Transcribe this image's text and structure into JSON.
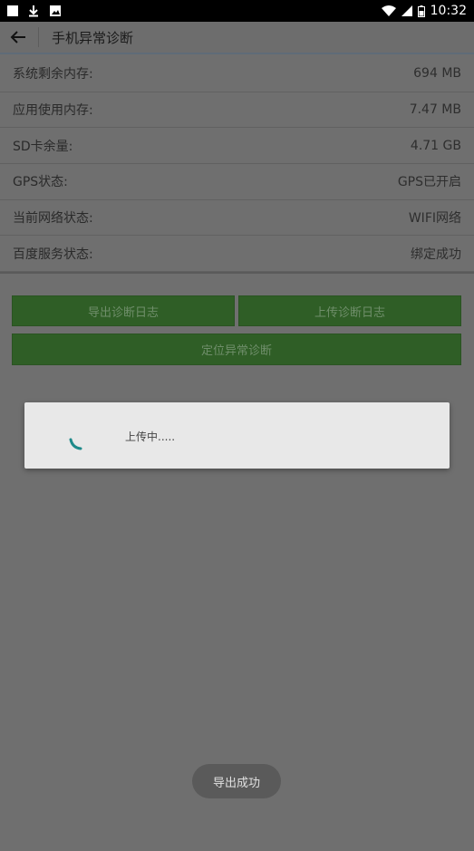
{
  "statusbar": {
    "time": "10:32",
    "icons": [
      "app-notification-icon",
      "download-icon",
      "image-icon",
      "wifi-icon",
      "signal-icon",
      "battery-icon"
    ]
  },
  "appbar": {
    "title": "手机异常诊断"
  },
  "info_rows": [
    {
      "label": "系统剩余内存:",
      "value": "694 MB"
    },
    {
      "label": "应用使用内存:",
      "value": "7.47 MB"
    },
    {
      "label": "SD卡余量:",
      "value": "4.71 GB"
    },
    {
      "label": "GPS状态:",
      "value": "GPS已开启"
    },
    {
      "label": "当前网络状态:",
      "value": "WIFI网络"
    },
    {
      "label": "百度服务状态:",
      "value": "绑定成功"
    }
  ],
  "buttons": {
    "export_log": "导出诊断日志",
    "upload_log": "上传诊断日志",
    "locate_diagnose": "定位异常诊断"
  },
  "dialog": {
    "message": "上传中....."
  },
  "toast": {
    "message": "导出成功"
  },
  "colors": {
    "button_bg": "#2f5e26",
    "spinner": "#1e8a8a",
    "overlay": "#6f6f6f"
  }
}
